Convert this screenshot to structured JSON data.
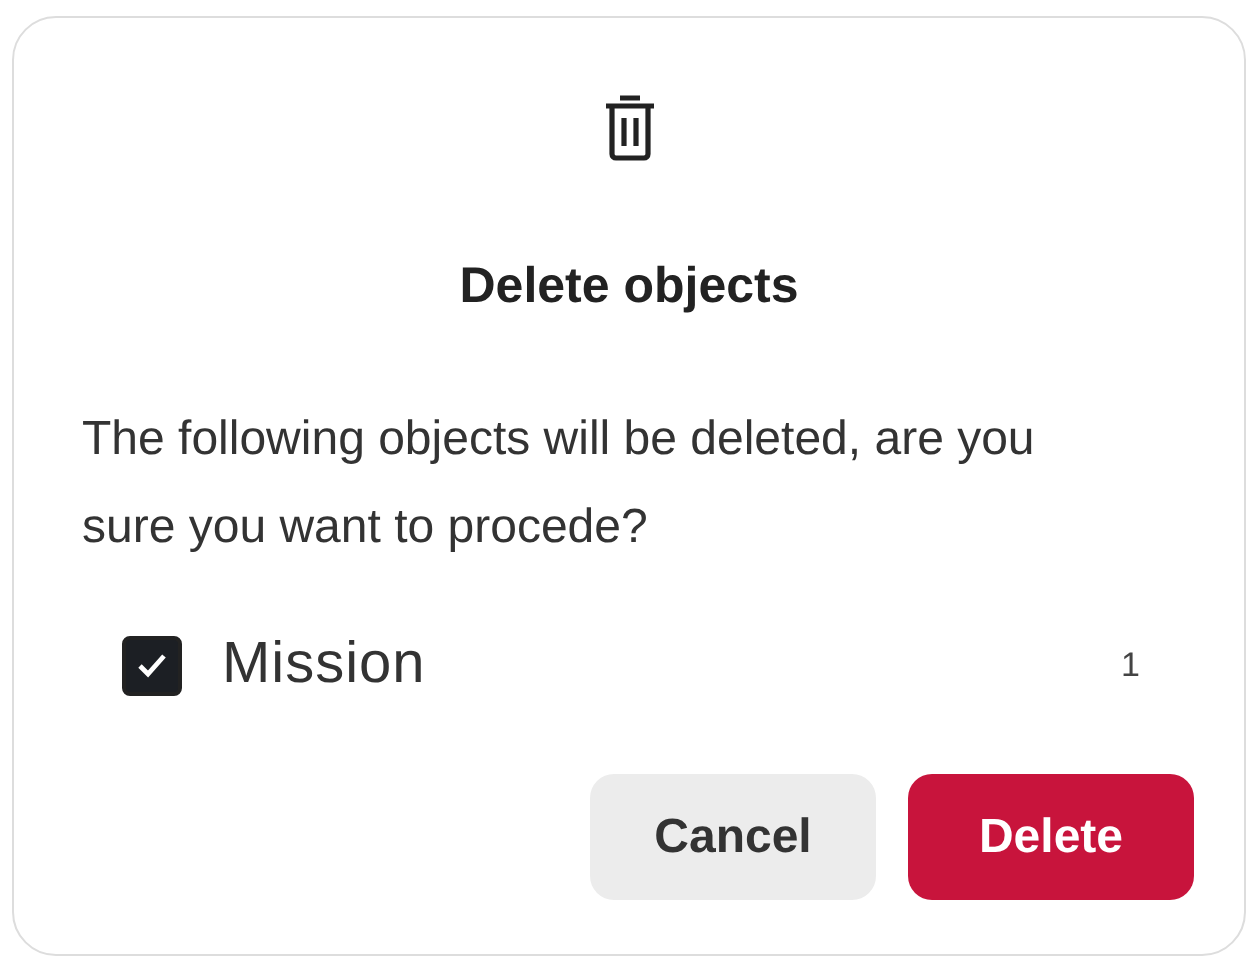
{
  "dialog": {
    "title": "Delete objects",
    "message": "The following objects will be deleted, are you sure you want to procede?",
    "items": [
      {
        "label": "Mission",
        "checked": true,
        "count": "1"
      }
    ],
    "buttons": [
      {
        "kind": "secondary",
        "label": "Cancel"
      },
      {
        "kind": "danger",
        "label": "Delete"
      }
    ]
  }
}
